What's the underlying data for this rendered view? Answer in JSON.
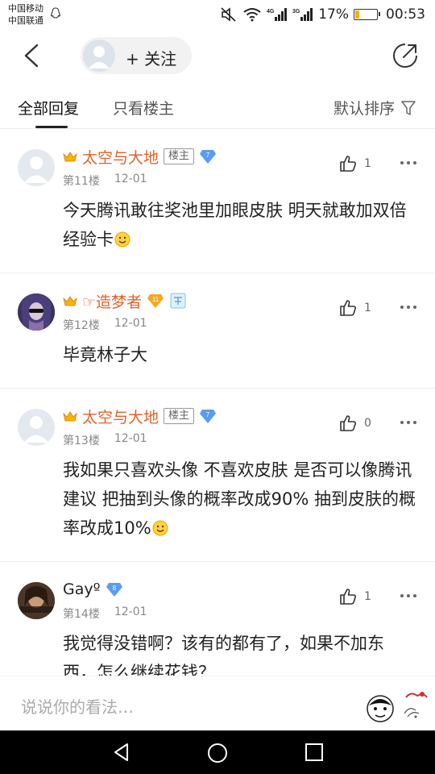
{
  "status": {
    "carrier1": "中国移动",
    "carrier2": "中国联通",
    "battery_percent": "17%",
    "battery_level": 0.17,
    "time": "00:53",
    "net1": "4G",
    "net2": "3G"
  },
  "header": {
    "follow_label": "+ 关注"
  },
  "tabs": {
    "all": "全部回复",
    "owner_only": "只看楼主",
    "sort": "默认排序"
  },
  "replies": [
    {
      "username": "太空与大地",
      "owner_badge": "楼主",
      "level": "7",
      "floor": "第11楼",
      "date": "12-01",
      "likes": "1",
      "content": "今天腾讯敢往奖池里加眼皮肤 明天就敢加双倍经验卡"
    },
    {
      "username": "☞造梦者",
      "level": "11",
      "floor": "第12楼",
      "date": "12-01",
      "likes": "1",
      "content": "毕竟林子大"
    },
    {
      "username": "太空与大地",
      "owner_badge": "楼主",
      "level": "7",
      "floor": "第13楼",
      "date": "12-01",
      "likes": "0",
      "content": "我如果只喜欢头像 不喜欢皮肤 是否可以像腾讯建议 把抽到头像的概率改成90% 抽到皮肤的概率改成10%"
    },
    {
      "username": "Gayº",
      "level": "8",
      "floor": "第14楼",
      "date": "12-01",
      "likes": "1",
      "content": "我觉得没错啊？该有的都有了，如果不加东西，怎么继续花钱？"
    }
  ],
  "input": {
    "placeholder": "说说你的看法…"
  },
  "colors": {
    "username_vip": "#e2622a",
    "level_badge": "#5b9cf0",
    "tab_indicator": "#222222"
  }
}
